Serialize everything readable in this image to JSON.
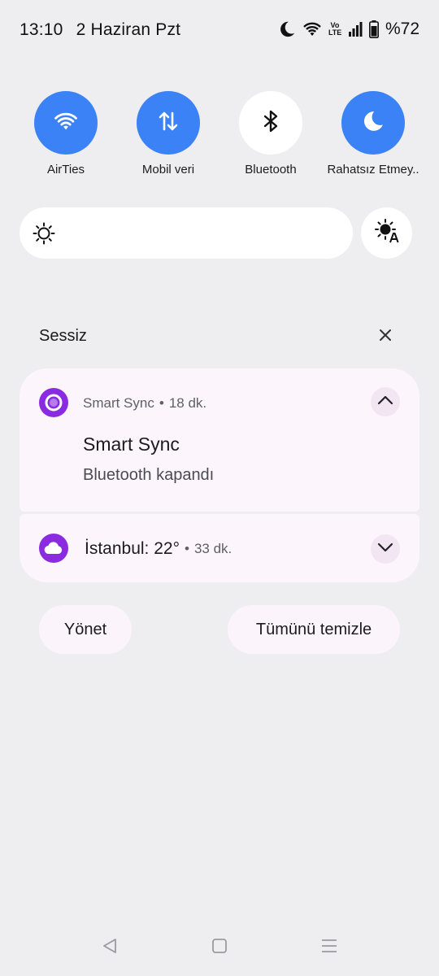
{
  "status_bar": {
    "time": "13:10",
    "date": "2 Haziran Pzt",
    "network_label": "Vo LTE",
    "battery": "%72"
  },
  "quick_settings": [
    {
      "label": "AirTies",
      "icon": "wifi-icon",
      "active": true
    },
    {
      "label": "Mobil veri",
      "icon": "mobile-data-icon",
      "active": true
    },
    {
      "label": "Bluetooth",
      "icon": "bluetooth-icon",
      "active": false
    },
    {
      "label": "Rahatsız Etmey..",
      "icon": "moon-icon",
      "active": true
    }
  ],
  "brightness": {
    "icon": "sun-icon",
    "auto_icon": "auto-brightness-icon"
  },
  "silent_section": {
    "title": "Sessiz"
  },
  "notifications": [
    {
      "app": "Smart Sync",
      "time": "18 dk.",
      "title": "Smart Sync",
      "body": "Bluetooth kapandı",
      "expanded": true
    },
    {
      "title": "İstanbul: 22°",
      "time": "33 dk.",
      "expanded": false
    }
  ],
  "actions": {
    "manage": "Yönet",
    "clear_all": "Tümünü temizle"
  },
  "colors": {
    "accent": "#3b82f6",
    "app_icon": "#8a2be2",
    "card": "#fcf5fc",
    "background": "#eeeef0"
  }
}
